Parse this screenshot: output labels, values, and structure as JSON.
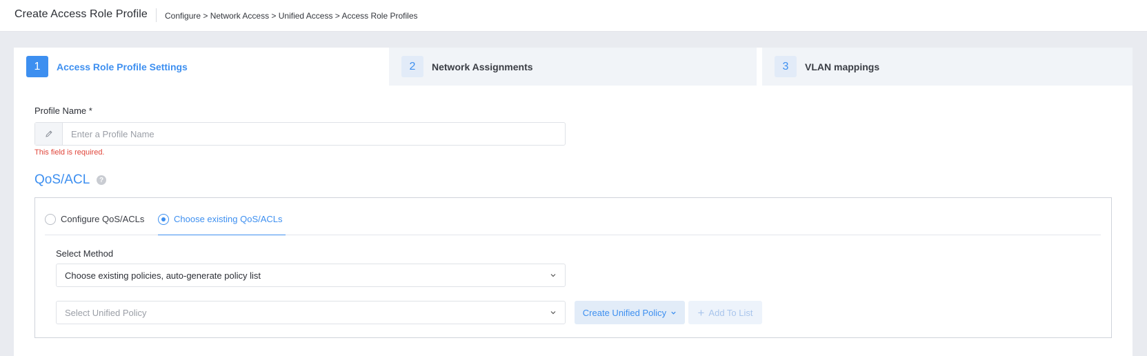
{
  "header": {
    "title": "Create Access Role Profile",
    "breadcrumb": "Configure > Network Access > Unified Access > Access Role Profiles"
  },
  "steps": [
    {
      "number": "1",
      "label": "Access Role Profile Settings",
      "active": true
    },
    {
      "number": "2",
      "label": "Network Assignments",
      "active": false
    },
    {
      "number": "3",
      "label": "VLAN mappings",
      "active": false
    }
  ],
  "profile": {
    "label": "Profile Name *",
    "value": "",
    "placeholder": "Enter a Profile Name",
    "error": "This field is required."
  },
  "qos": {
    "title": "QoS/ACL",
    "help": "?",
    "tabs": [
      {
        "label": "Configure QoS/ACLs",
        "selected": false
      },
      {
        "label": "Choose existing QoS/ACLs",
        "selected": true
      }
    ],
    "method_label": "Select Method",
    "method_value": "Choose existing policies, auto-generate policy list",
    "policy_placeholder": "Select Unified Policy",
    "create_button": "Create Unified Policy",
    "add_button": "Add To List"
  },
  "colors": {
    "accent": "#3d8ff0",
    "error": "#e0453a",
    "background": "#e9ebf0"
  }
}
